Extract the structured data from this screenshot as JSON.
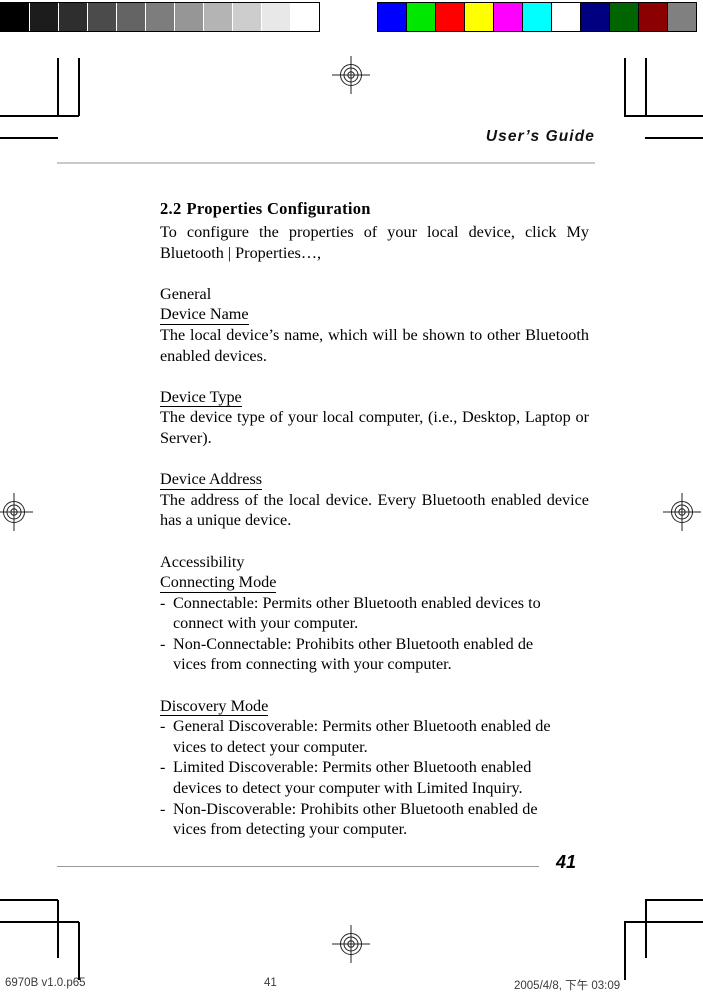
{
  "calibration": {
    "gray_bar": {
      "name": "grayscale-calibration-bar",
      "swatches": [
        "#000000",
        "#1c1c1c",
        "#2e2e2e",
        "#4b4b4b",
        "#646464",
        "#7d7d7d",
        "#969696",
        "#b4b4b4",
        "#cdcdcd",
        "#e8e8e8",
        "#ffffff"
      ]
    },
    "color_bar": {
      "name": "color-calibration-bar",
      "swatches": [
        "#0000ff",
        "#00e800",
        "#fe0000",
        "#ffff00",
        "#ff00ff",
        "#00ffff",
        "#ffffff",
        "#000080",
        "#006400",
        "#8b0000",
        "#808080"
      ]
    }
  },
  "header": {
    "running_head": "User’s Guide"
  },
  "content": {
    "section_number": "2.2",
    "section_title": "Properties Configuration",
    "intro": "To configure the properties of your local device, click My Bluetooth | Properties…,",
    "groups": [
      {
        "group_label": "General",
        "entries": [
          {
            "subhead": "Device Name",
            "body": "The local device’s name, which will be shown to other Bluetooth enabled devices."
          },
          {
            "subhead": "Device Type",
            "body": "The device type of your local computer, (i.e., Desktop, Laptop or Server)."
          },
          {
            "subhead": "Device Address",
            "body": "The address of the local device. Every Bluetooth enabled device has a unique device."
          }
        ]
      },
      {
        "group_label": "Accessibility",
        "entries": [
          {
            "subhead": "Connecting Mode",
            "items": [
              {
                "dash": "-",
                "line1": "Connectable: Permits other Bluetooth enabled devices to",
                "line2": "connect with your computer."
              },
              {
                "dash": "-",
                "line1": "Non-Connectable: Prohibits other Bluetooth enabled de",
                "line2": "vices from connecting with your computer."
              }
            ]
          },
          {
            "subhead": "Discovery Mode",
            "items": [
              {
                "dash": "-",
                "line1": "General Discoverable: Permits other Bluetooth enabled de",
                "line2": "vices to detect your computer."
              },
              {
                "dash": "-",
                "line1": "Limited Discoverable: Permits other Bluetooth enabled",
                "line2": "devices to detect your computer with Limited Inquiry."
              },
              {
                "dash": "-",
                "line1": "Non-Discoverable: Prohibits other Bluetooth enabled de",
                "line2": "vices from detecting your computer."
              }
            ]
          }
        ]
      }
    ]
  },
  "footer": {
    "page_number": "41"
  },
  "scan_footer": {
    "file_name": "6970B v1.0.p65",
    "page_number": "41",
    "timestamp": "2005/4/8, 下午 03:09"
  }
}
